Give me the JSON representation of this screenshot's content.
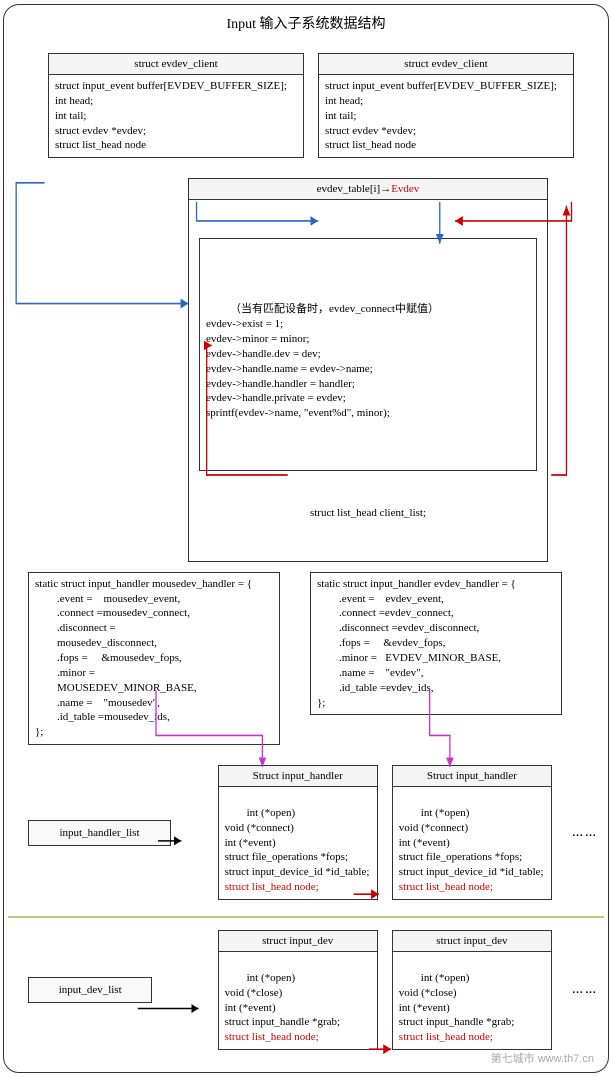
{
  "page": {
    "title": "Input 输入子系统数据结构"
  },
  "evdev_client": {
    "title": "struct evdev_client",
    "body": "struct input_event buffer[EVDEV_BUFFER_SIZE];\nint head;\nint tail;\nstruct evdev *evdev;\nstruct list_head node"
  },
  "evdev_table": {
    "header_pre": "evdev_table[i]→",
    "header_red": "Evdev",
    "note": "（当有匹配设备时，evdev_connect中赋值）",
    "body": "evdev->exist = 1;\nevdev->minor = minor;\nevdev->handle.dev = dev;\nevdev->handle.name = evdev->name;\nevdev->handle.handler = handler;\nevdev->handle.private = evdev;\nsprintf(evdev->name, \"event%d\", minor);",
    "footer": "struct list_head client_list;"
  },
  "mousedev_handler": {
    "body": "static struct input_handler mousedev_handler = {\n        .event =    mousedev_event,\n        .connect =mousedev_connect,\n        .disconnect =\n        mousedev_disconnect,\n        .fops =     &mousedev_fops,\n        .minor =\n        MOUSEDEV_MINOR_BASE,\n        .name =    \"mousedev\",\n        .id_table =mousedev_ids,\n};"
  },
  "evdev_handler": {
    "body": "static struct input_handler evdev_handler = {\n        .event =    evdev_event,\n        .connect =evdev_connect,\n        .disconnect =evdev_disconnect,\n        .fops =     &evdev_fops,\n        .minor =   EVDEV_MINOR_BASE,\n        .name =    \"evdev\",\n        .id_table =evdev_ids,\n};"
  },
  "input_handler": {
    "title": "Struct input_handler",
    "body": "int (*open)\nvoid (*connect)\nint (*event)\nstruct file_operations *fops;\nstruct input_device_id *id_table;",
    "node": "struct list_head node;"
  },
  "input_dev": {
    "title": "struct input_dev",
    "body": "int (*open)\nvoid (*close)\nint (*event)\nstruct input_handle *grab;",
    "node": "struct list_head node;"
  },
  "lists": {
    "handler": "input_handler_list",
    "dev": "input_dev_list"
  },
  "ellipsis": "……",
  "watermark": "第七城市    www.th7.cn"
}
